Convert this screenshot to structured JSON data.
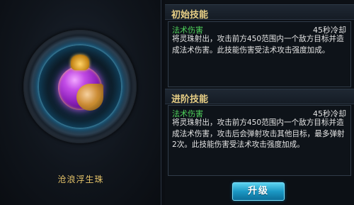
{
  "item": {
    "name": "沧浪浮生珠"
  },
  "initial_skill": {
    "header": "初始技能",
    "type": "法术伤害",
    "cooldown": "45秒冷却",
    "description": "将灵珠射出，攻击前方450范围内一个敌方目标并造成法术伤害。此技能伤害受法术攻击强度加成。"
  },
  "advanced_skill": {
    "header": "进阶技能",
    "type": "法术伤害",
    "cooldown": "45秒冷却",
    "description": "将灵珠射出，攻击前方450范围内一个敌方目标并造成法术伤害，攻击后会弹射攻击其他目标，最多弹射2次。此技能伤害受法术攻击强度加成。"
  },
  "actions": {
    "upgrade_label": "升级"
  }
}
